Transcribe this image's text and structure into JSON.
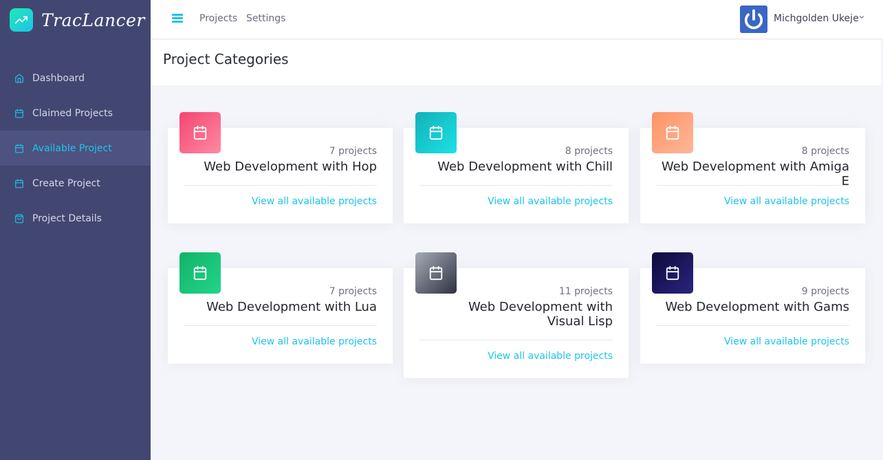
{
  "brand": {
    "name": "TracLancer",
    "logo_icon": "trending-up-icon"
  },
  "sidebar": {
    "items": [
      {
        "label": "Dashboard",
        "icon": "home-icon",
        "active": false
      },
      {
        "label": "Claimed Projects",
        "icon": "calendar-icon",
        "active": false
      },
      {
        "label": "Available Project",
        "icon": "calendar-icon",
        "active": true
      },
      {
        "label": "Create Project",
        "icon": "calendar-icon",
        "active": false
      },
      {
        "label": "Project Details",
        "icon": "shopping-bag-icon",
        "active": false
      }
    ]
  },
  "header": {
    "links": [
      "Projects",
      "Settings"
    ],
    "user": {
      "name": "Michgolden Ukeje"
    }
  },
  "page": {
    "title": "Project Categories"
  },
  "categories": [
    {
      "count": "7 projects",
      "name": "Web Development with Hop",
      "link": "View all available projects",
      "color": "#f44571"
    },
    {
      "count": "8 projects",
      "name": "Web Development with Chill",
      "link": "View all available projects",
      "color": "#19c0c9"
    },
    {
      "count": "8 projects",
      "name": "Web Development with Amiga E",
      "link": "View all available projects",
      "color": "#fea470"
    },
    {
      "count": "7 projects",
      "name": "Web Development with Lua",
      "link": "View all available projects",
      "color": "#12b86e"
    },
    {
      "count": "11 projects",
      "name": "Web Development with Visual Lisp",
      "link": "View all available projects",
      "color": "#5b5e6e"
    },
    {
      "count": "9 projects",
      "name": "Web Development with Gams",
      "link": "View all available projects",
      "color": "#1b1656"
    }
  ],
  "colors": {
    "accent": "#1dc4e9",
    "sidebar_bg": "#424772"
  }
}
